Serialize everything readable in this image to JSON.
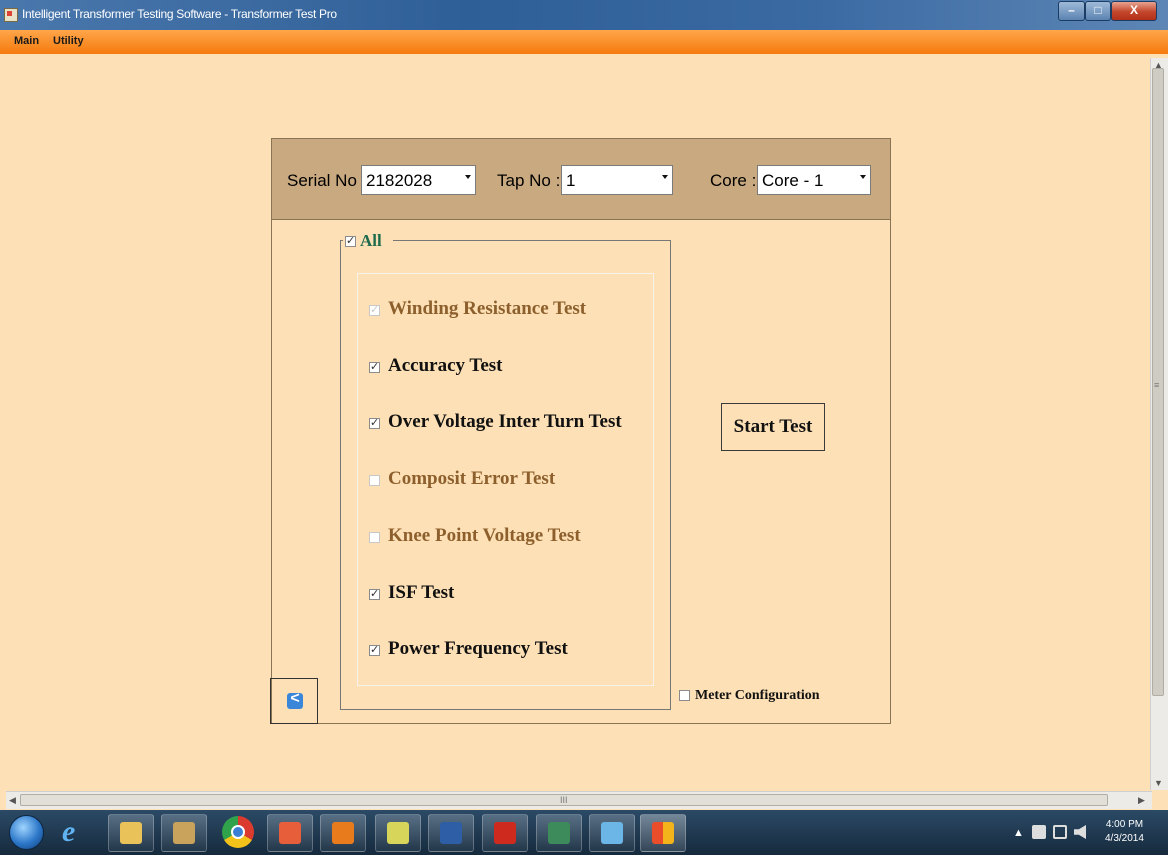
{
  "window": {
    "title": "Intelligent Transformer Testing Software - Transformer Test Pro",
    "minimize_glyph": "–",
    "maximize_glyph": "□",
    "close_glyph": "X"
  },
  "menu": {
    "items": [
      {
        "label": "Main"
      },
      {
        "label": "Utility"
      }
    ]
  },
  "selectors": {
    "serial": {
      "label": "Serial No :",
      "value": "2182028"
    },
    "tap": {
      "label": "Tap No :",
      "value": "1"
    },
    "core": {
      "label": "Core :",
      "value": "Core - 1"
    }
  },
  "tests": {
    "all_label": "All",
    "all_checked": true,
    "items": [
      {
        "label": "Winding Resistance Test",
        "checked": true,
        "enabled": false
      },
      {
        "label": "Accuracy Test",
        "checked": true,
        "enabled": true
      },
      {
        "label": "Over Voltage Inter Turn Test",
        "checked": true,
        "enabled": true
      },
      {
        "label": "Composit Error Test",
        "checked": false,
        "enabled": false
      },
      {
        "label": "Knee Point Voltage Test",
        "checked": false,
        "enabled": false
      },
      {
        "label": "ISF Test",
        "checked": true,
        "enabled": true
      },
      {
        "label": "Power Frequency Test",
        "checked": true,
        "enabled": true
      }
    ]
  },
  "actions": {
    "start_test_label": "Start Test",
    "meter_config_label": "Meter Configuration",
    "meter_config_checked": false,
    "back_glyph": "<"
  },
  "scrollbars": {
    "up_arrow": "▲",
    "down_arrow": "▼",
    "left_arrow": "◀",
    "right_arrow": "▶",
    "v_grip": "≡",
    "h_grip": "III"
  },
  "taskbar": {
    "time": "4:00 PM",
    "date": "4/3/2014",
    "tray_arrow": "▲"
  },
  "colors": {
    "background": "#fde0b5",
    "header_panel": "#c9a97f",
    "menubar": "#f57a0c",
    "disabled_text": "#8c5f2c",
    "all_label": "#1e6b4e"
  }
}
